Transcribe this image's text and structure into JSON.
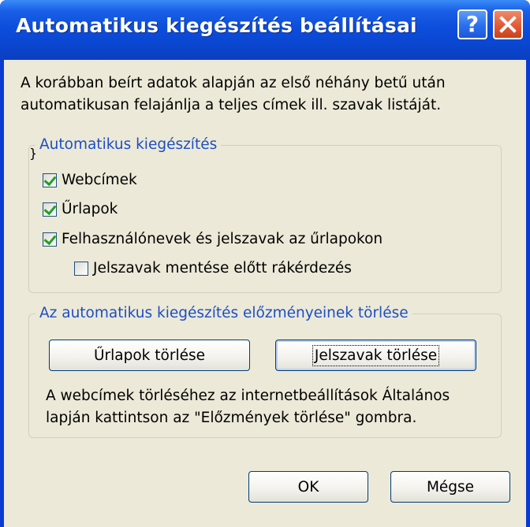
{
  "window": {
    "title": "Automatikus kiegészítés beállításai",
    "help_label": "?"
  },
  "intro": "A korábban beírt adatok alapján az első néhány betű után automatikusan felajánlja a teljes címek ill. szavak listáját.",
  "autocomplete_group": {
    "title": "Automatikus kiegészítés",
    "options": [
      {
        "label": "Webcímek",
        "checked": true
      },
      {
        "label": "Űrlapok",
        "checked": true
      },
      {
        "label": "Felhasználónevek és jelszavak az űrlapokon",
        "checked": true
      },
      {
        "label": "Jelszavak mentése előtt rákérdezés",
        "checked": false
      }
    ]
  },
  "history_group": {
    "title": "Az automatikus kiegészítés előzményeinek törlése",
    "clear_forms_label": "Űrlapok törlése",
    "clear_passwords_label": "Jelszavak törlése",
    "note": "A webcímek törléséhez az internetbeállítások Általános lapján kattintson az \"Előzmények törlése\" gombra."
  },
  "footer": {
    "ok_label": "OK",
    "cancel_label": "Mégse"
  },
  "colors": {
    "title_bar": "#0a47d3",
    "dialog_bg": "#ece9d8",
    "group_title": "#1c4fc4",
    "check": "#21a121"
  }
}
